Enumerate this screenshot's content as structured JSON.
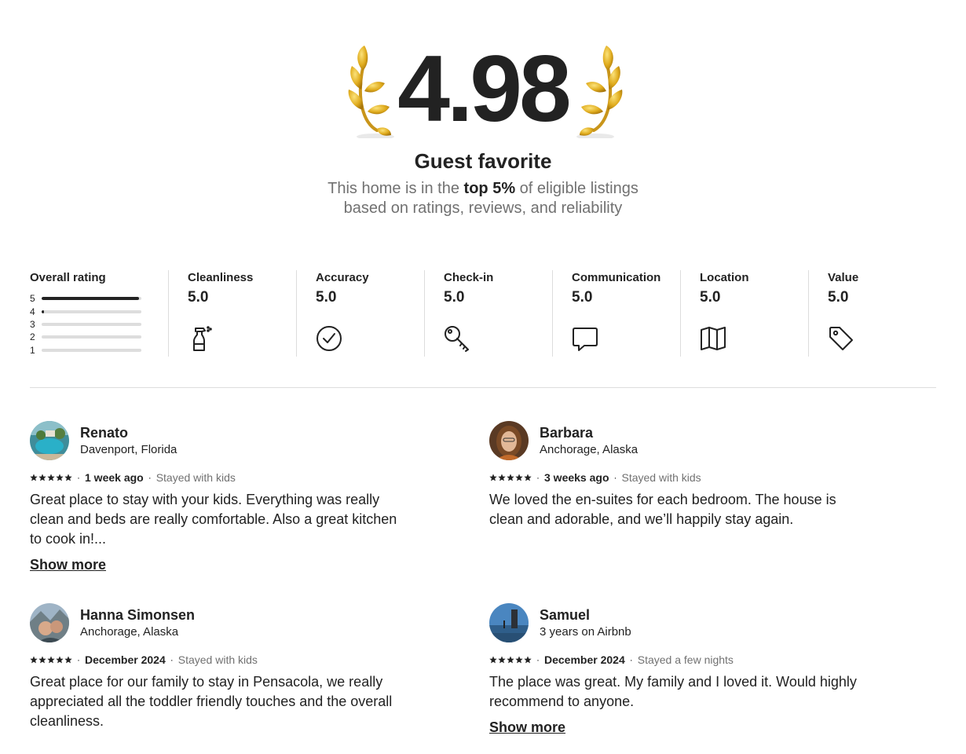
{
  "hero": {
    "score": "4.98",
    "title": "Guest favorite",
    "subtitle_pre": "This home is in the ",
    "subtitle_bold": "top 5%",
    "subtitle_post": " of eligible listings",
    "subtitle_line2": "based on ratings, reviews, and reliability"
  },
  "overall": {
    "label": "Overall rating",
    "distribution": [
      {
        "stars": "5",
        "fraction": 0.98
      },
      {
        "stars": "4",
        "fraction": 0.02
      },
      {
        "stars": "3",
        "fraction": 0
      },
      {
        "stars": "2",
        "fraction": 0
      },
      {
        "stars": "1",
        "fraction": 0
      }
    ]
  },
  "categories": [
    {
      "label": "Cleanliness",
      "score": "5.0",
      "icon": "spray-bottle-icon"
    },
    {
      "label": "Accuracy",
      "score": "5.0",
      "icon": "check-circle-icon"
    },
    {
      "label": "Check-in",
      "score": "5.0",
      "icon": "key-icon"
    },
    {
      "label": "Communication",
      "score": "5.0",
      "icon": "chat-bubble-icon"
    },
    {
      "label": "Location",
      "score": "5.0",
      "icon": "map-icon"
    },
    {
      "label": "Value",
      "score": "5.0",
      "icon": "tag-icon"
    }
  ],
  "reviews": [
    {
      "name": "Renato",
      "location": "Davenport, Florida",
      "rating": 5,
      "when": "1 week ago",
      "stay": "Stayed with kids",
      "text": "Great place to stay with your kids. Everything was really clean and beds are really comfortable. Also a great kitchen to cook in!...",
      "show_more": "Show more"
    },
    {
      "name": "Barbara",
      "location": "Anchorage, Alaska",
      "rating": 5,
      "when": "3 weeks ago",
      "stay": "Stayed with kids",
      "text": "We loved the en-suites for each bedroom. The house is clean and adorable, and we’ll happily stay again.",
      "show_more": ""
    },
    {
      "name": "Hanna Simonsen",
      "location": "Anchorage, Alaska",
      "rating": 5,
      "when": "December 2024",
      "stay": "Stayed with kids",
      "text": "Great place for our family to stay in Pensacola, we really appreciated all the toddler friendly touches and the overall cleanliness.",
      "show_more": ""
    },
    {
      "name": "Samuel",
      "location": "3 years on Airbnb",
      "rating": 5,
      "when": "December 2024",
      "stay": "Stayed a few nights",
      "text": "The place was great. My family and I loved it. Would highly recommend to anyone.",
      "show_more": "Show more"
    }
  ],
  "colors": {
    "text": "#222222",
    "muted": "#717171",
    "divider": "#dddddd",
    "laurel_gold": "#d8a520"
  }
}
